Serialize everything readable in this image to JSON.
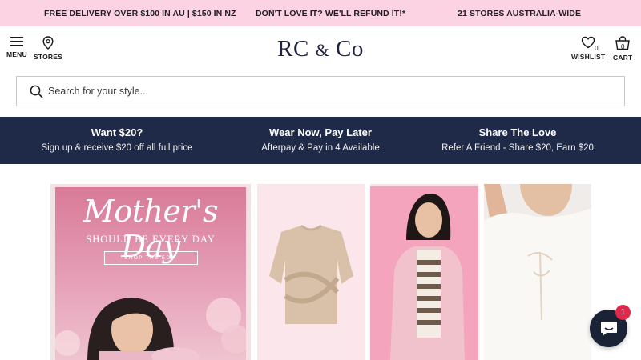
{
  "promo": {
    "delivery": "FREE DELIVERY OVER $100 IN AU | $150 IN NZ",
    "refund": "DON'T LOVE IT? WE'LL REFUND IT!*",
    "stores": "21 STORES AUSTRALIA-WIDE"
  },
  "header": {
    "logo_main": "RC",
    "logo_amp": "&",
    "logo_end": "Co",
    "menu_label": "MENU",
    "stores_label": "STORES",
    "wishlist_label": "WISHLIST",
    "wishlist_count": "0",
    "cart_label": "CART",
    "cart_count": "0"
  },
  "search": {
    "placeholder": "Search for your style..."
  },
  "benefits": [
    {
      "title": "Want $20?",
      "subtitle": "Sign up & receive $20 off all full price"
    },
    {
      "title": "Wear Now, Pay Later",
      "subtitle": "Afterpay & Pay in 4 Available"
    },
    {
      "title": "Share The Love",
      "subtitle": "Refer A Friend - Share $20, Earn $20"
    }
  ],
  "hero": {
    "title": "Mother's Day",
    "subtitle": "SHOULD BE EVERY DAY",
    "cta": "SHOP THE EDIT"
  },
  "chat": {
    "badge": "1"
  },
  "colors": {
    "promo_bg": "#fcd3e3",
    "benefits_bg": "#1e2a47",
    "hero_pink": "#d87a98",
    "chat_bg": "#1a2236",
    "badge": "#e0294a"
  }
}
